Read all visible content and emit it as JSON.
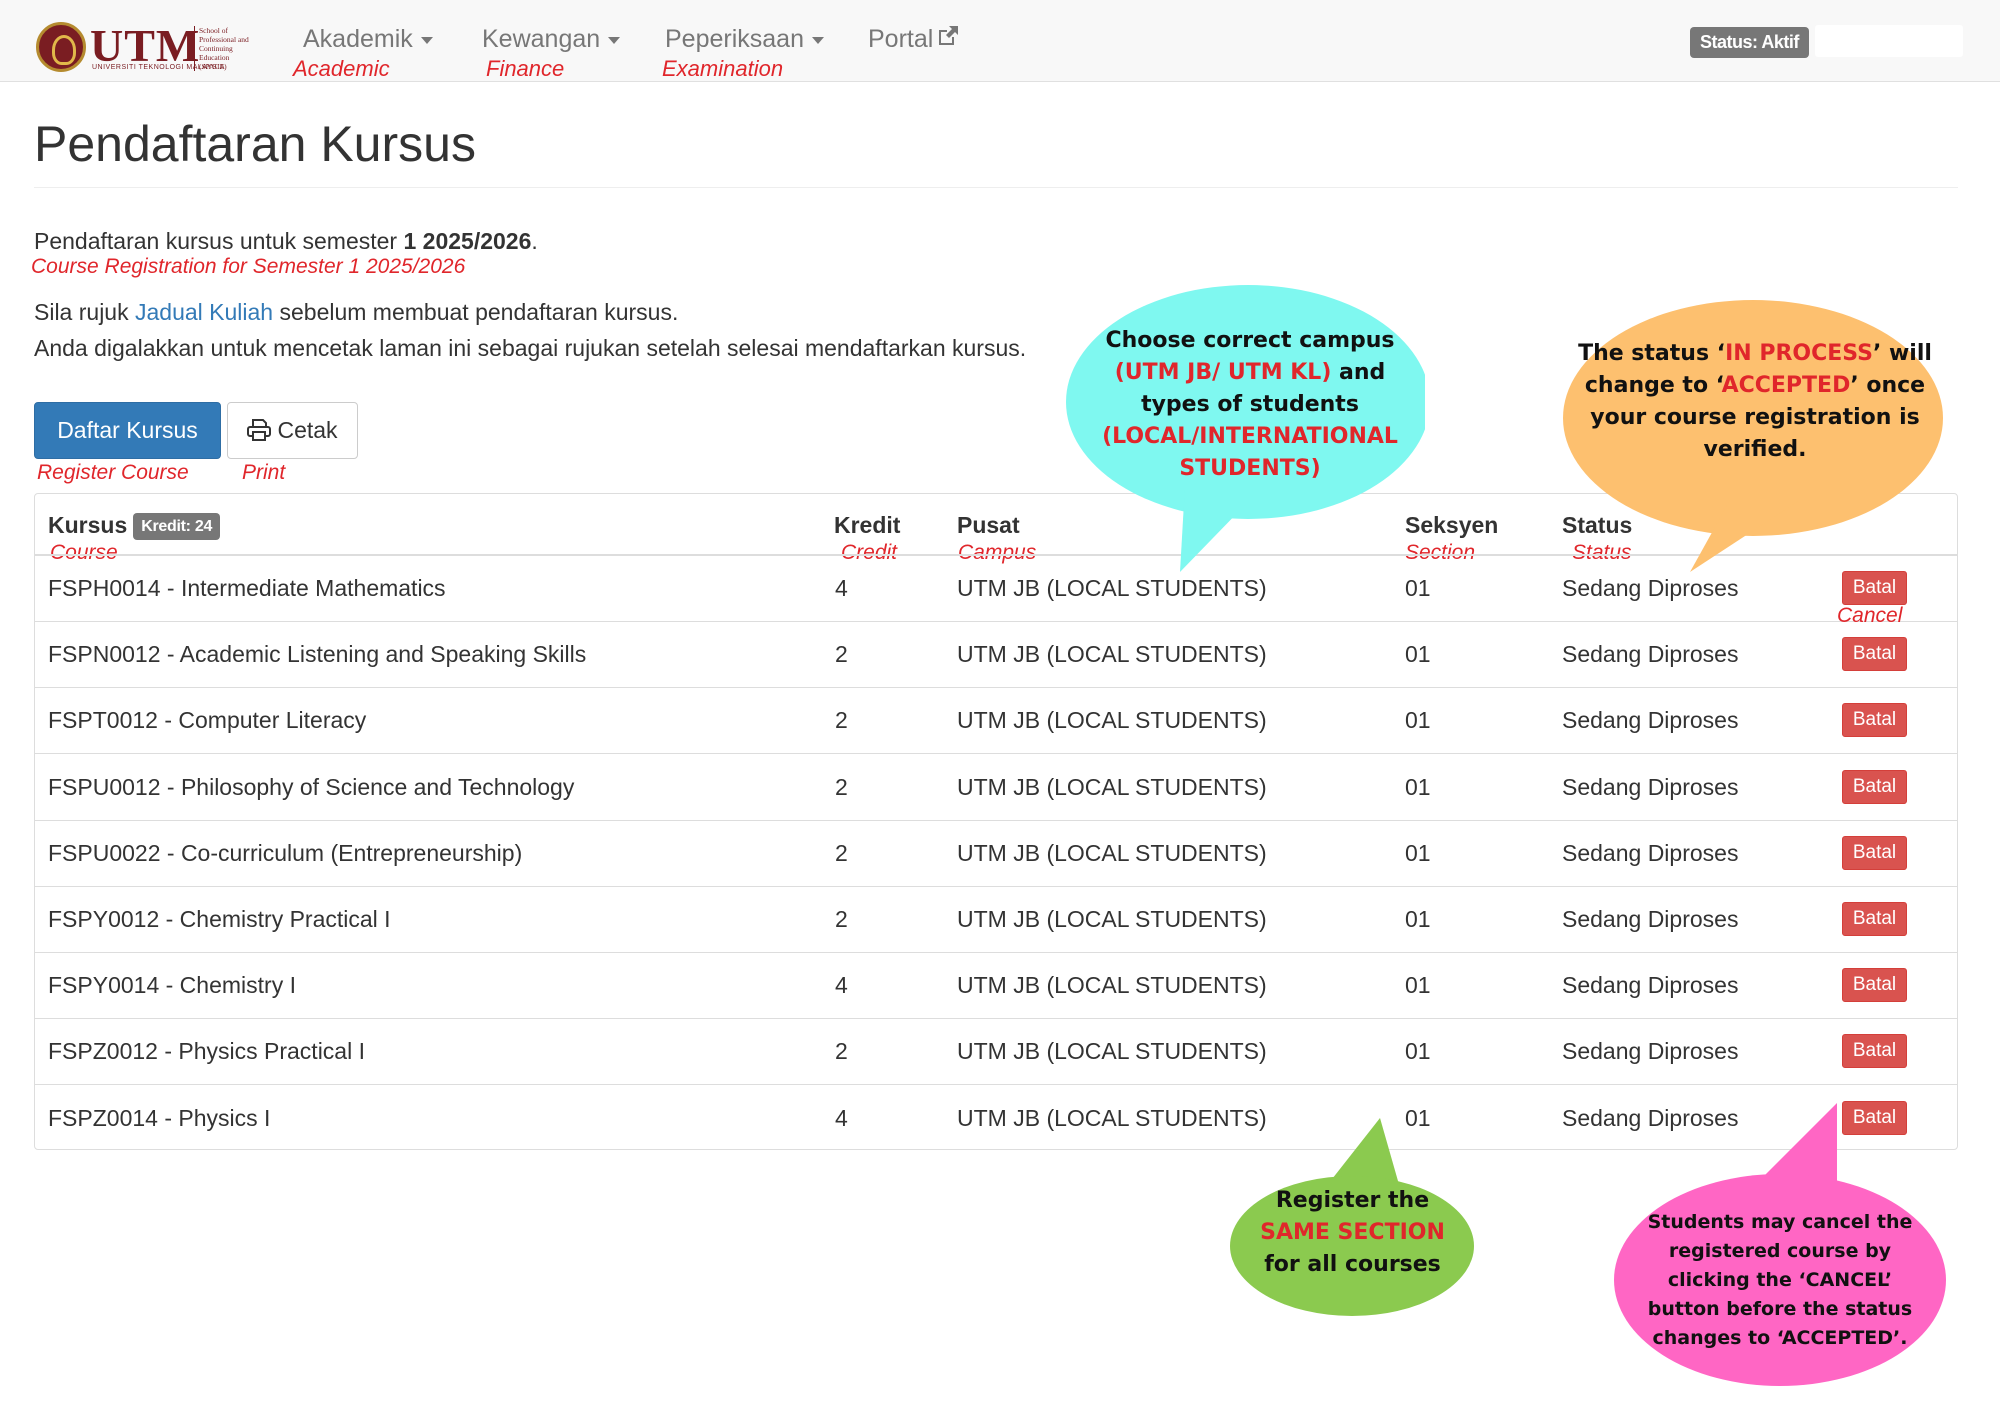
{
  "navbar": {
    "logo_text": "UTM",
    "logo_subtitle": "UNIVERSITI TEKNOLOGI MALAYSIA",
    "logo_side_text": "School of Professional and Continuing Education (SPACE)",
    "items": [
      {
        "label": "Akademik",
        "translation": "Academic",
        "has_dropdown": true
      },
      {
        "label": "Kewangan",
        "translation": "Finance",
        "has_dropdown": true
      },
      {
        "label": "Peperiksaan",
        "translation": "Examination",
        "has_dropdown": true
      },
      {
        "label": "Portal",
        "translation": "",
        "has_dropdown": false,
        "icon": "external-link-icon"
      }
    ],
    "status_label": "Status: Aktif"
  },
  "page": {
    "title": "Pendaftaran Kursus",
    "intro_prefix": "Pendaftaran kursus untuk semester ",
    "semester": "1 2025/2026",
    "intro_suffix": ".",
    "intro_translation": "Course Registration for Semester 1 2025/2026",
    "refer_prefix": "Sila rujuk ",
    "refer_link": "Jadual Kuliah",
    "refer_suffix": " sebelum membuat pendaftaran kursus.",
    "print_advice": "Anda digalakkan untuk mencetak laman ini sebagai rujukan setelah selesai mendaftarkan kursus."
  },
  "buttons": {
    "register_label": "Daftar Kursus",
    "register_translation": "Register Course",
    "print_label": "Cetak",
    "print_translation": "Print"
  },
  "table": {
    "headers": {
      "course": "Kursus",
      "course_translation": "Course",
      "credit_badge": "Kredit: 24",
      "credit": "Kredit",
      "credit_translation": "Credit",
      "campus": "Pusat",
      "campus_translation": "Campus",
      "section": "Seksyen",
      "section_translation": "Section",
      "status": "Status",
      "status_translation": "Status"
    },
    "cancel_label": "Batal",
    "cancel_translation": "Cancel",
    "rows": [
      {
        "course": "FSPH0014 - Intermediate Mathematics",
        "credit": "4",
        "campus": "UTM JB (LOCAL STUDENTS)",
        "section": "01",
        "status": "Sedang Diproses"
      },
      {
        "course": "FSPN0012 - Academic Listening and Speaking Skills",
        "credit": "2",
        "campus": "UTM JB (LOCAL STUDENTS)",
        "section": "01",
        "status": "Sedang Diproses"
      },
      {
        "course": "FSPT0012 - Computer Literacy",
        "credit": "2",
        "campus": "UTM JB (LOCAL STUDENTS)",
        "section": "01",
        "status": "Sedang Diproses"
      },
      {
        "course": "FSPU0012 - Philosophy of Science and Technology",
        "credit": "2",
        "campus": "UTM JB (LOCAL STUDENTS)",
        "section": "01",
        "status": "Sedang Diproses"
      },
      {
        "course": "FSPU0022 - Co-curriculum (Entrepreneurship)",
        "credit": "2",
        "campus": "UTM JB (LOCAL STUDENTS)",
        "section": "01",
        "status": "Sedang Diproses"
      },
      {
        "course": "FSPY0012 - Chemistry Practical I",
        "credit": "2",
        "campus": "UTM JB (LOCAL STUDENTS)",
        "section": "01",
        "status": "Sedang Diproses"
      },
      {
        "course": "FSPY0014 - Chemistry I",
        "credit": "4",
        "campus": "UTM JB (LOCAL STUDENTS)",
        "section": "01",
        "status": "Sedang Diproses"
      },
      {
        "course": "FSPZ0012 - Physics Practical I",
        "credit": "2",
        "campus": "UTM JB (LOCAL STUDENTS)",
        "section": "01",
        "status": "Sedang Diproses"
      },
      {
        "course": "FSPZ0014 - Physics I",
        "credit": "4",
        "campus": "UTM JB (LOCAL STUDENTS)",
        "section": "01",
        "status": "Sedang Diproses"
      }
    ]
  },
  "callouts": {
    "campus": {
      "line1": "Choose correct campus",
      "line2_red": "(UTM JB/ UTM KL)",
      "line2_rest": " and",
      "line3": "types of students",
      "line4_red": "(LOCAL/INTERNATIONAL",
      "line5_red": "STUDENTS)",
      "color": "#7ff8f0"
    },
    "status": {
      "l1a": "The status ‘",
      "l1red": "IN PROCESS",
      "l1b": "’ will",
      "l2a": "change to ‘",
      "l2red": "ACCEPTED",
      "l2b": "’ once",
      "l3": "your course registration is",
      "l4": "verified.",
      "color": "#fdc06f"
    },
    "section": {
      "line1": "Register the",
      "line2_red": "SAME SECTION",
      "line3": "for all courses",
      "color": "#8bca4f"
    },
    "cancel": {
      "line1": "Students may cancel the",
      "line2": "registered course by",
      "line3": "clicking the ‘CANCEL’",
      "line4": "button before the status",
      "line5": "changes to ‘ACCEPTED’.",
      "color": "#ff66c4"
    }
  },
  "colors": {
    "primary": "#337ab7",
    "danger": "#d9534f",
    "annotation_red": "#e0262b",
    "utm_maroon": "#7a1d22"
  }
}
